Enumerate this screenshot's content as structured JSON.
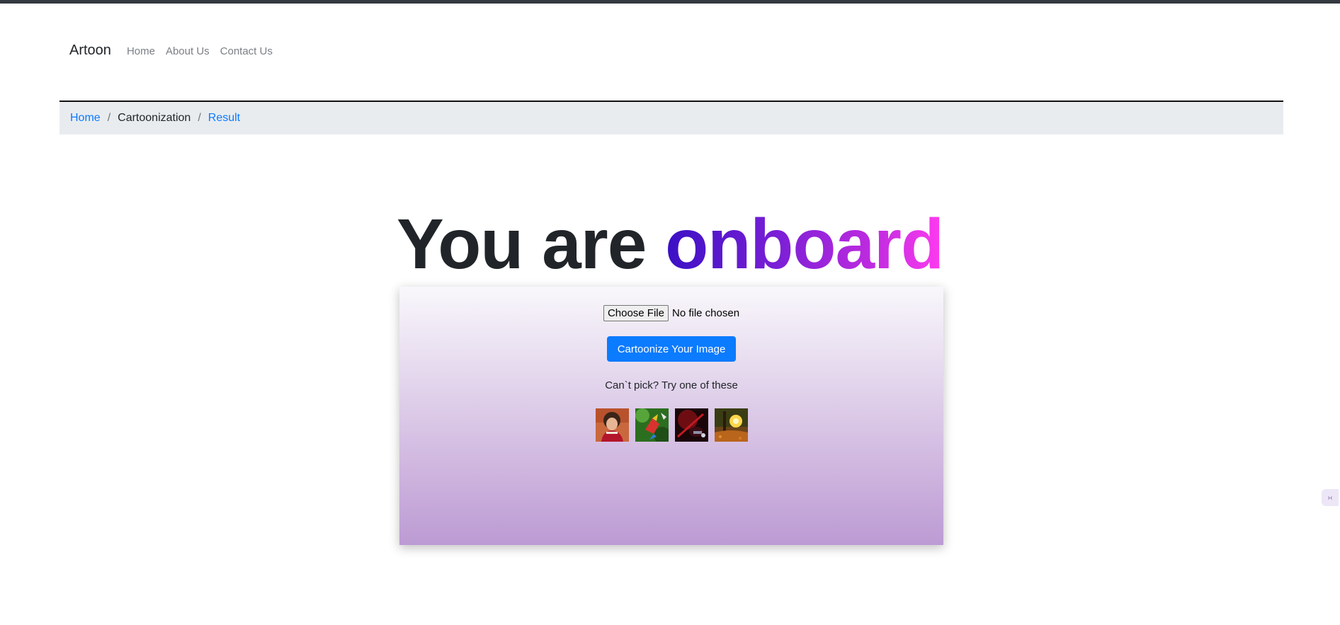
{
  "navbar": {
    "brand": "Artoon",
    "links": [
      "Home",
      "About Us",
      "Contact Us"
    ]
  },
  "breadcrumb": {
    "items": [
      {
        "label": "Home",
        "type": "link"
      },
      {
        "label": "Cartoonization",
        "type": "active"
      },
      {
        "label": "Result",
        "type": "link"
      }
    ],
    "separator": "/"
  },
  "hero": {
    "plain": "You are",
    "highlight": "onboard"
  },
  "upload": {
    "choose_label": "Choose File",
    "file_status": "No file chosen",
    "submit_label": "Cartoonize Your Image",
    "prompt": "Can`t pick? Try one of these",
    "samples": [
      {
        "name": "sample-image-girl"
      },
      {
        "name": "sample-image-parrot"
      },
      {
        "name": "sample-image-guitar"
      },
      {
        "name": "sample-image-forest"
      }
    ]
  },
  "colors": {
    "accent": "#0b7bff",
    "topbar": "#343a40",
    "breadcrumb_bg": "#e9ecef",
    "gradient_start": "#3a10c4",
    "gradient_end": "#ff3bf0"
  }
}
